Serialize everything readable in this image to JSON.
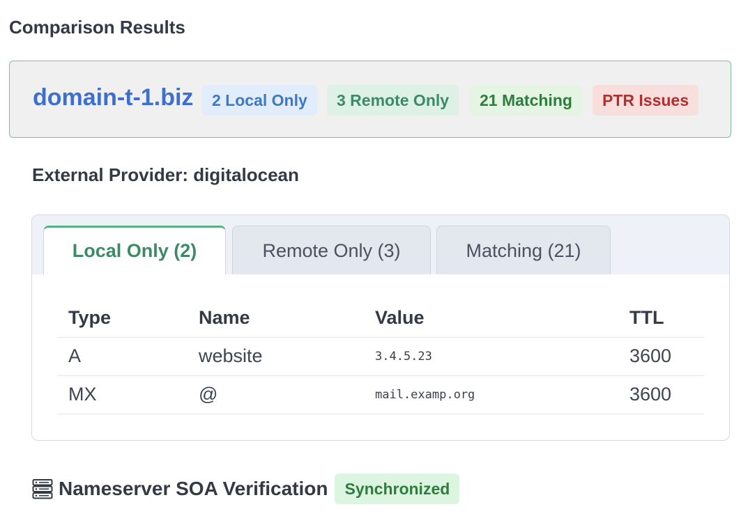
{
  "page": {
    "title": "Comparison Results"
  },
  "domain": {
    "name": "domain-t-1.biz",
    "badges": {
      "local_only": "2 Local Only",
      "remote_only": "3 Remote Only",
      "matching": "21 Matching",
      "ptr_issues": "PTR Issues"
    }
  },
  "provider": {
    "label": "External Provider: digitalocean"
  },
  "tabs": [
    {
      "label": "Local Only (2)",
      "active": true
    },
    {
      "label": "Remote Only (3)",
      "active": false
    },
    {
      "label": "Matching (21)",
      "active": false
    }
  ],
  "table": {
    "headers": {
      "type": "Type",
      "name": "Name",
      "value": "Value",
      "ttl": "TTL"
    },
    "rows": [
      {
        "type": "A",
        "name": "website",
        "value": "3.4.5.23",
        "ttl": "3600"
      },
      {
        "type": "MX",
        "name": "@",
        "value": "mail.examp.org",
        "ttl": "3600"
      }
    ]
  },
  "soa": {
    "icon": "server-icon",
    "title": "Nameserver SOA Verification",
    "status": "Synchronized"
  },
  "colors": {
    "accent_green": "#3d8b66",
    "link_blue": "#3d6fd1",
    "error_red": "#b22f2f"
  }
}
